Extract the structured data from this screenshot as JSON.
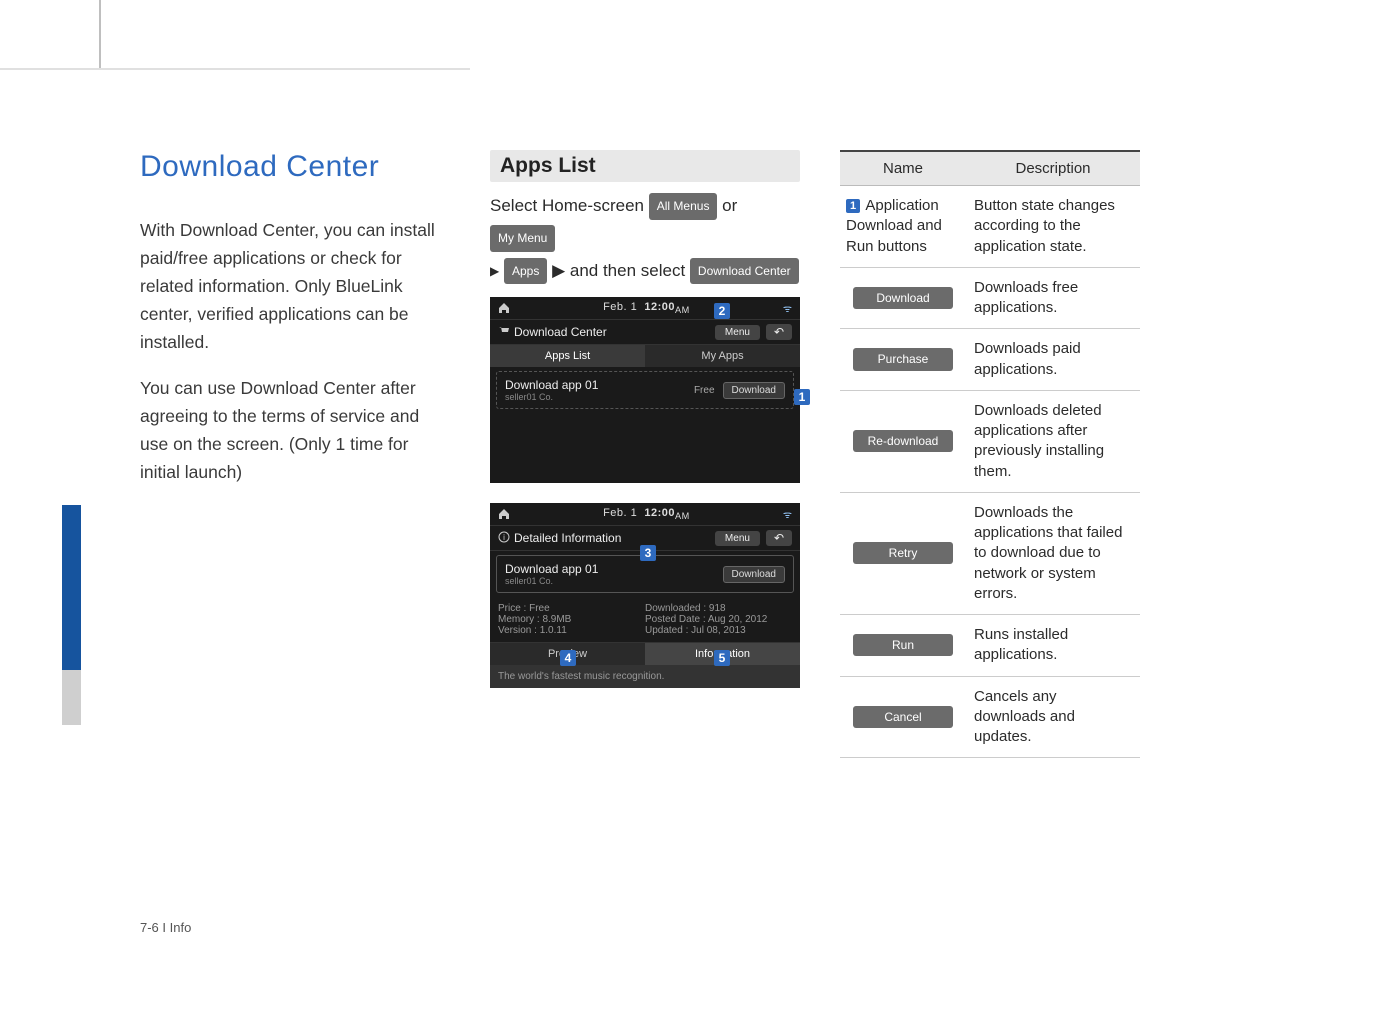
{
  "page_title": "Download Center",
  "intro_p1": "With Download Center, you can install paid/free applications or check for related information. Only BlueLink center, verified applications can be installed.",
  "intro_p2": "You can use Download Center after agreeing to the terms of service and use on the screen. (Only 1 time for initial launch)",
  "section_heading": "Apps List",
  "nav": {
    "prefix": "Select Home-screen",
    "all_menus": "All Menus",
    "or": "or",
    "my_menu": "My Menu",
    "arrow": "▶",
    "apps": "Apps",
    "mid": "▶ and then select",
    "download_center": "Download Center"
  },
  "shot1": {
    "date": "Feb. 1",
    "time": "12:00",
    "ampm": "AM",
    "title": "Download Center",
    "menu": "Menu",
    "tab_apps": "Apps List",
    "tab_my": "My Apps",
    "row_name": "Download app 01",
    "row_seller": "seller01 Co.",
    "row_price": "Free",
    "row_btn": "Download",
    "callout1": "1",
    "callout2": "2"
  },
  "shot2": {
    "date": "Feb. 1",
    "time": "12:00",
    "ampm": "AM",
    "title": "Detailed Information",
    "menu": "Menu",
    "row_name": "Download app 01",
    "row_seller": "seller01 Co.",
    "row_btn": "Download",
    "l_price": "Price : Free",
    "l_mem": "Memory : 8.9MB",
    "l_ver": "Version : 1.0.11",
    "r_dl": "Downloaded : 918",
    "r_posted": "Posted Date : Aug 20, 2012",
    "r_updated": "Updated : Jul 08, 2013",
    "tab_preview": "Preview",
    "tab_info": "Information",
    "footer": "The world's fastest music recognition.",
    "callout3": "3",
    "callout4": "4",
    "callout5": "5"
  },
  "table": {
    "head_name": "Name",
    "head_desc": "Description",
    "rows": [
      {
        "callout": "1",
        "name": "Application Download and Run buttons",
        "desc": "Button state changes according to the application state."
      },
      {
        "btn": "Download",
        "desc": "Downloads free applications."
      },
      {
        "btn": "Purchase",
        "desc": "Downloads paid applications."
      },
      {
        "btn": "Re-download",
        "desc": "Downloads deleted applications after previously installing them."
      },
      {
        "btn": "Retry",
        "desc": "Downloads the applications that failed to download due to network or system errors."
      },
      {
        "btn": "Run",
        "desc": "Runs installed applications."
      },
      {
        "btn": "Cancel",
        "desc": "Cancels any downloads and updates."
      }
    ]
  },
  "page_footer": "7-6 I Info"
}
